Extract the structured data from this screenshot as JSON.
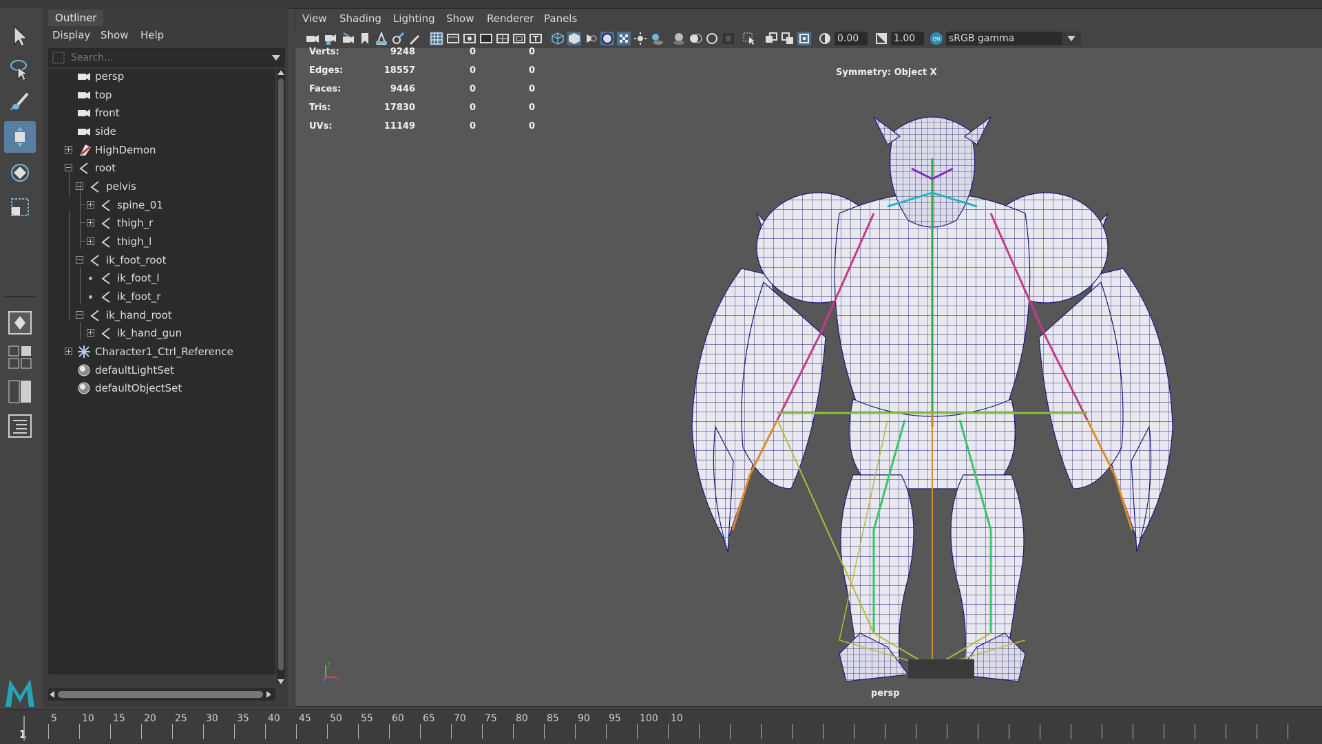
{
  "outliner": {
    "title": "Outliner",
    "menu": [
      "Display",
      "Show",
      "Help"
    ],
    "search_placeholder": "Search...",
    "items": [
      {
        "label": "persp",
        "icon": "camera-icon"
      },
      {
        "label": "top",
        "icon": "camera-icon"
      },
      {
        "label": "front",
        "icon": "camera-icon"
      },
      {
        "label": "side",
        "icon": "camera-icon"
      },
      {
        "label": "HighDemon",
        "icon": "mesh-transform-icon"
      },
      {
        "label": "root",
        "icon": "joint-icon"
      },
      {
        "label": "pelvis",
        "icon": "joint-icon"
      },
      {
        "label": "spine_01",
        "icon": "joint-icon"
      },
      {
        "label": "thigh_r",
        "icon": "joint-icon"
      },
      {
        "label": "thigh_l",
        "icon": "joint-icon"
      },
      {
        "label": "ik_foot_root",
        "icon": "joint-icon"
      },
      {
        "label": "ik_foot_l",
        "icon": "joint-icon"
      },
      {
        "label": "ik_foot_r",
        "icon": "joint-icon"
      },
      {
        "label": "ik_hand_root",
        "icon": "joint-icon"
      },
      {
        "label": "ik_hand_gun",
        "icon": "joint-icon"
      },
      {
        "label": "Character1_Ctrl_Reference",
        "icon": "hik-reference-icon"
      },
      {
        "label": "defaultLightSet",
        "icon": "set-icon"
      },
      {
        "label": "defaultObjectSet",
        "icon": "set-icon"
      }
    ]
  },
  "viewport": {
    "menu": [
      "View",
      "Shading",
      "Lighting",
      "Show",
      "Renderer",
      "Panels"
    ],
    "exposure": "0.00",
    "gamma": "1.00",
    "color_space": "sRGB gamma",
    "symmetry": "Symmetry: Object X",
    "camera_label": "persp",
    "stats": [
      {
        "label": "Verts:",
        "value": "9248",
        "sel": "0",
        "comp": "0"
      },
      {
        "label": "Edges:",
        "value": "18557",
        "sel": "0",
        "comp": "0"
      },
      {
        "label": "Faces:",
        "value": "9446",
        "sel": "0",
        "comp": "0"
      },
      {
        "label": "Tris:",
        "value": "17830",
        "sel": "0",
        "comp": "0"
      },
      {
        "label": "UVs:",
        "value": "11149",
        "sel": "0",
        "comp": "0"
      }
    ]
  },
  "timeline": {
    "current_frame": "1",
    "labels": [
      "5",
      "10",
      "15",
      "20",
      "25",
      "30",
      "35",
      "40",
      "45",
      "50",
      "55",
      "60",
      "65",
      "70",
      "75",
      "80",
      "85",
      "90",
      "95",
      "100",
      "10"
    ]
  },
  "colors": {
    "accent": "#5a7ea1",
    "wire": "#1a1a7a",
    "mesh": "#e6e6ea"
  }
}
